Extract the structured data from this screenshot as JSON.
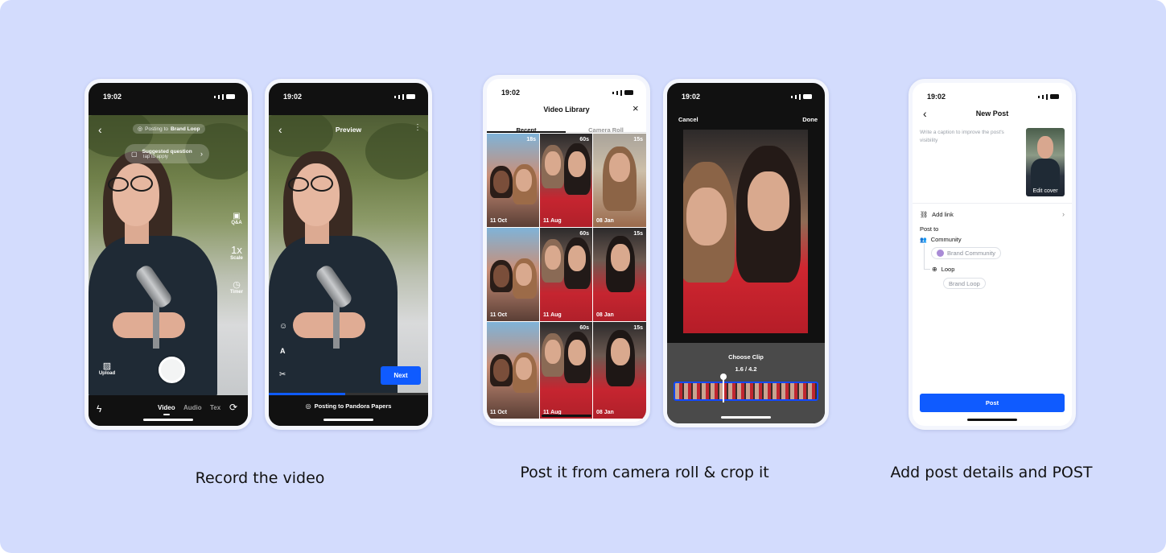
{
  "captions": {
    "record": "Record the video",
    "camera_roll": "Post it from camera roll & crop it",
    "post": "Add post details and POST"
  },
  "status_time": "19:02",
  "screen1": {
    "posting_to_prefix": "Posting to",
    "posting_to_target": "Brand Loop",
    "suggested_question": "Suggested question",
    "tap_to_apply": "Tap to apply",
    "side_tools": [
      "Q&A",
      "Scale",
      "Timer"
    ],
    "scale_value": "1x",
    "upload_label": "Upload",
    "modes": [
      "Video",
      "Audio",
      "Tex"
    ]
  },
  "screen2": {
    "title": "Preview",
    "next_button": "Next",
    "posting_to": "Posting to Pandora Papers"
  },
  "screen3": {
    "title": "Video Library",
    "tabs": [
      "Recent",
      "Camera Roll"
    ],
    "cells": [
      {
        "date": "11 Oct",
        "duration": "18s"
      },
      {
        "date": "11 Aug",
        "duration": "60s"
      },
      {
        "date": "08 Jan",
        "duration": "15s"
      },
      {
        "date": "11 Oct",
        "duration": ""
      },
      {
        "date": "11 Aug",
        "duration": "60s"
      },
      {
        "date": "08 Jan",
        "duration": "15s"
      },
      {
        "date": "11 Oct",
        "duration": ""
      },
      {
        "date": "11 Aug",
        "duration": "60s"
      },
      {
        "date": "08 Jan",
        "duration": "15s"
      }
    ]
  },
  "screen4": {
    "cancel": "Cancel",
    "done": "Done",
    "choose_clip": "Choose Clip",
    "clip_range": "1.6 / 4.2"
  },
  "screen5": {
    "title": "New Post",
    "caption_placeholder": "Write a caption to improve the post's visibility",
    "edit_cover": "Edit cover",
    "add_link": "Add link",
    "post_to": "Post to",
    "community": "Community",
    "brand_community": "Brand Community",
    "loop": "Loop",
    "brand_loop": "Brand Loop",
    "post_button": "Post"
  },
  "colors": {
    "background": "#d3dcfd",
    "accent_blue": "#0f5bff"
  }
}
